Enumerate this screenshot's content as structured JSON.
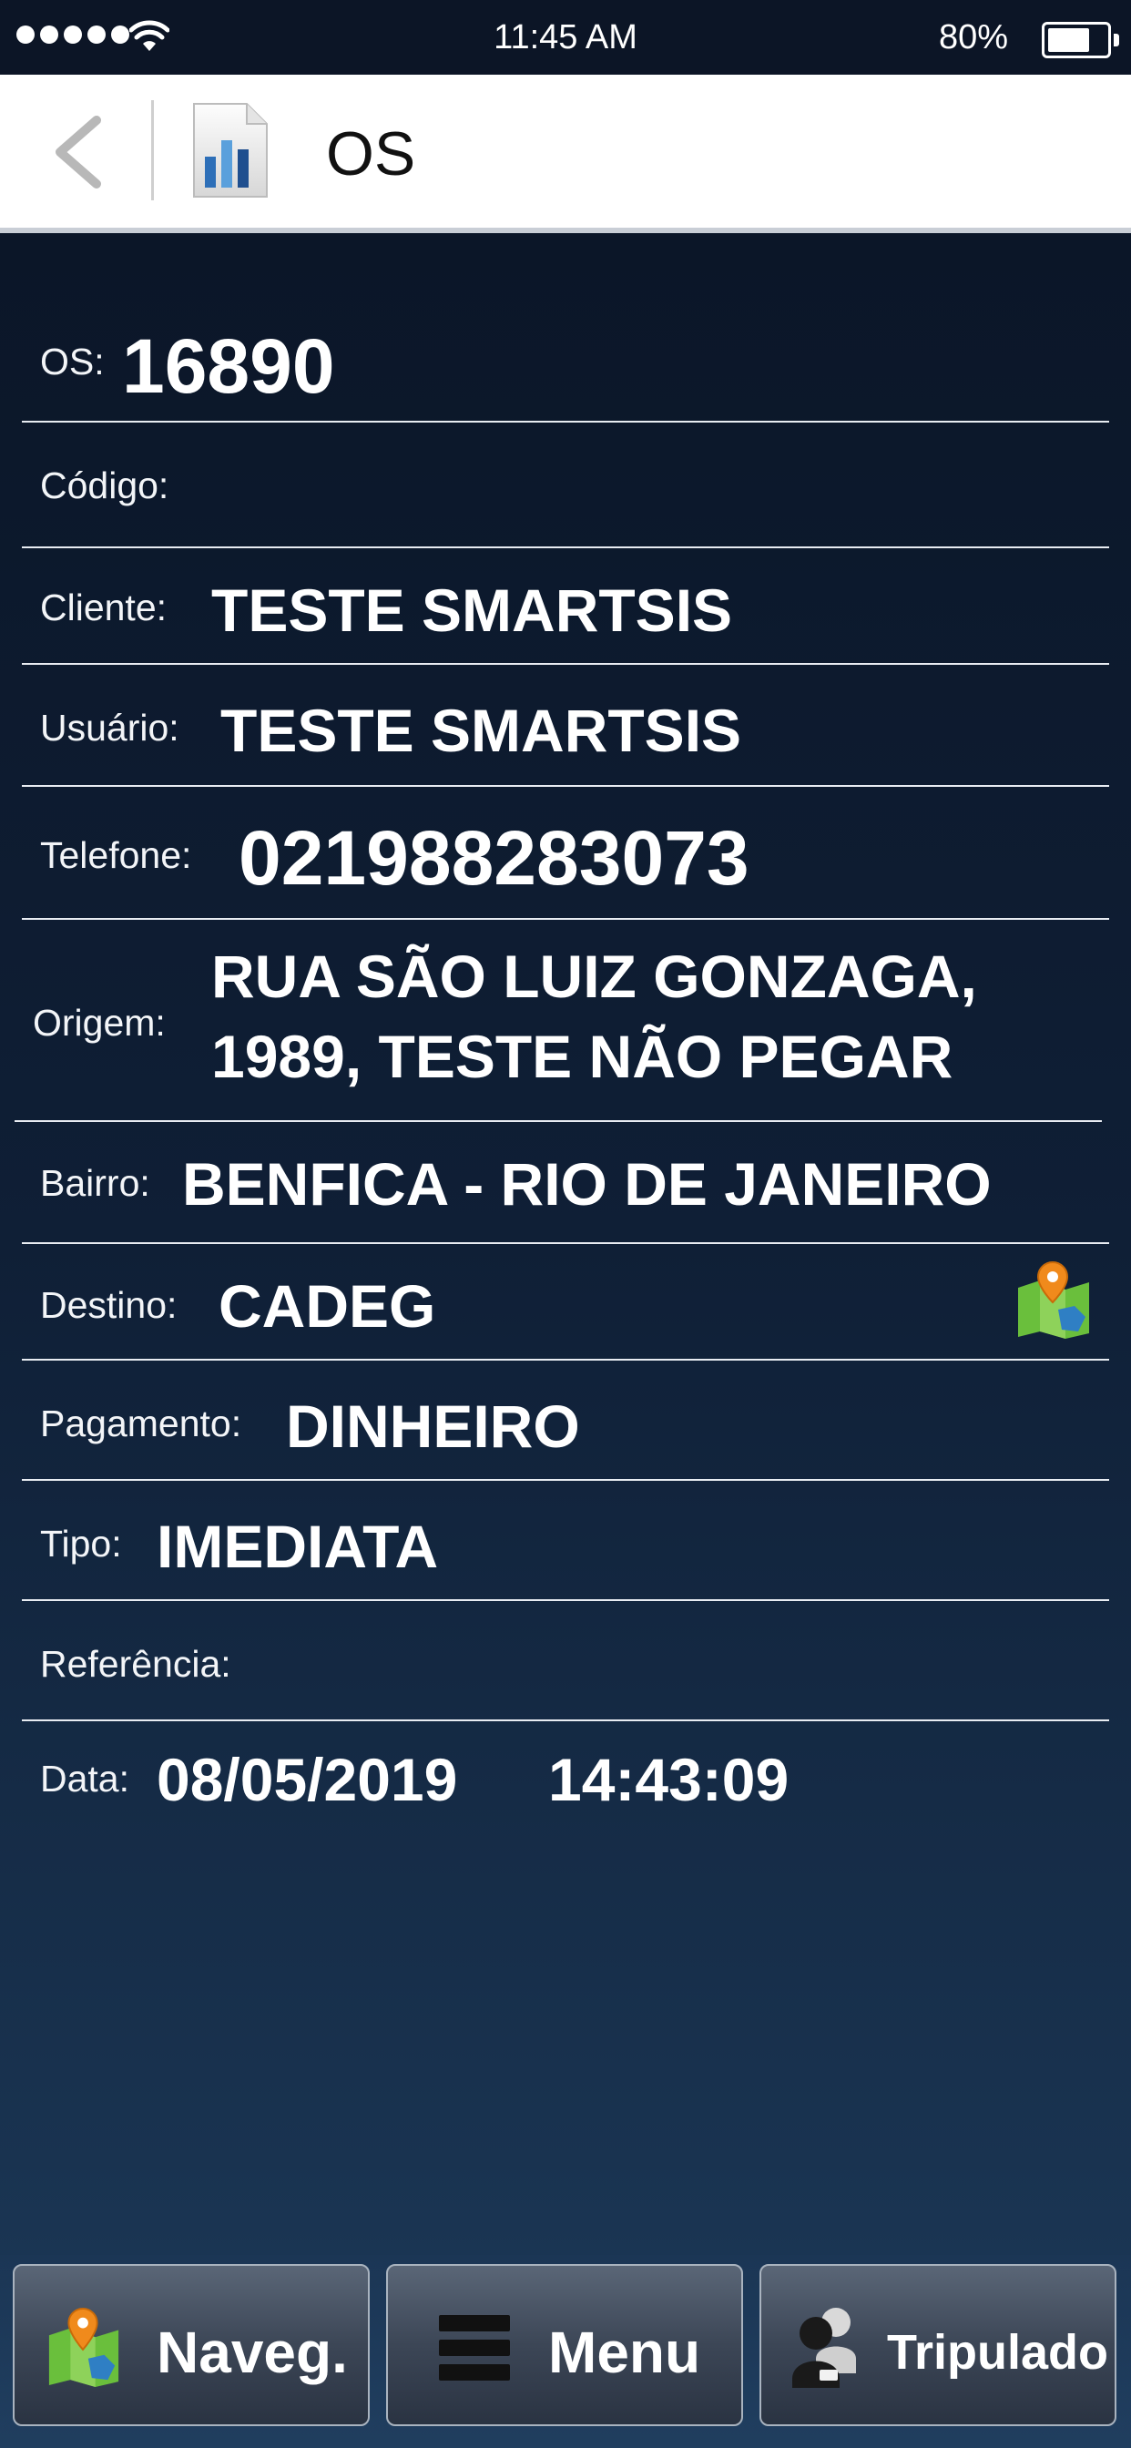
{
  "status_bar": {
    "time": "11:45 AM",
    "battery_percent": "80%",
    "battery_level": 0.8,
    "signal_bars": 5
  },
  "header": {
    "title": "OS",
    "back_icon": "chevron-left-icon",
    "app_icon": "bar-chart-icon"
  },
  "fields": {
    "os": {
      "label": "OS:",
      "value": "16890"
    },
    "codigo": {
      "label": "Código:",
      "value": ""
    },
    "cliente": {
      "label": "Cliente:",
      "value": "TESTE SMARTSIS"
    },
    "usuario": {
      "label": "Usuário:",
      "value": "TESTE SMARTSIS"
    },
    "telefone": {
      "label": "Telefone:",
      "value": "021988283073"
    },
    "origem": {
      "label": "Origem:",
      "value_line1": "RUA SÃO LUIZ GONZAGA,",
      "value_line2": "1989, TESTE NÃO PEGAR"
    },
    "bairro": {
      "label": "Bairro:",
      "value": "BENFICA - RIO DE JANEIRO"
    },
    "destino": {
      "label": "Destino:",
      "value": "CADEG",
      "icon": "map-pin-icon"
    },
    "pagamento": {
      "label": "Pagamento:",
      "value": "DINHEIRO"
    },
    "tipo": {
      "label": "Tipo:",
      "value": "IMEDIATA"
    },
    "referencia": {
      "label": "Referência:",
      "value": ""
    },
    "data": {
      "label": "Data:",
      "date": "08/05/2019",
      "time": "14:43:09"
    }
  },
  "bottom_bar": {
    "naveg": {
      "label": "Naveg.",
      "icon": "map-icon"
    },
    "menu": {
      "label": "Menu",
      "icon": "menu-icon"
    },
    "tripulado": {
      "label": "Tripulado",
      "icon": "crew-icon"
    }
  },
  "colors": {
    "background_top": "#0b1628",
    "background_bottom": "#1a3553",
    "header_bg": "#ffffff",
    "divider": "#e8ecf2"
  }
}
